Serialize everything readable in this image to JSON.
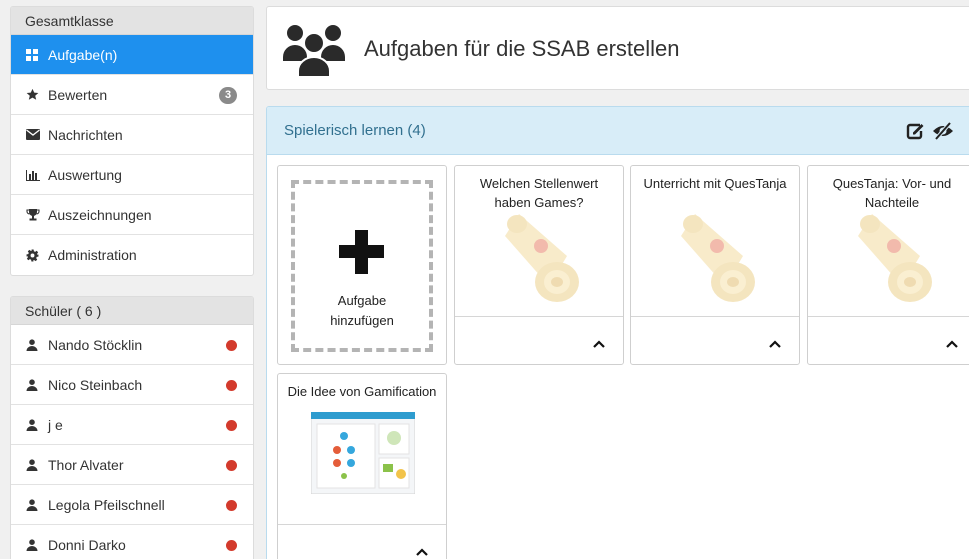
{
  "sidebar": {
    "class_panel": {
      "header": "Gesamtklasse",
      "items": [
        {
          "label": "Aufgabe(n)",
          "icon": "grid-icon",
          "active": true
        },
        {
          "label": "Bewerten",
          "icon": "star-icon",
          "badge": "3"
        },
        {
          "label": "Nachrichten",
          "icon": "envelope-icon"
        },
        {
          "label": "Auswertung",
          "icon": "bar-chart-icon"
        },
        {
          "label": "Auszeichnungen",
          "icon": "trophy-icon"
        },
        {
          "label": "Administration",
          "icon": "gear-icon"
        }
      ]
    },
    "students_panel": {
      "header": "Schüler ( 6 )",
      "items": [
        {
          "name": "Nando Stöcklin",
          "status_color": "#d33a2c"
        },
        {
          "name": "Nico Steinbach",
          "status_color": "#d33a2c"
        },
        {
          "name": "j e",
          "status_color": "#d33a2c"
        },
        {
          "name": "Thor Alvater",
          "status_color": "#d33a2c"
        },
        {
          "name": "Legola Pfeilschnell",
          "status_color": "#d33a2c"
        },
        {
          "name": "Donni Darko",
          "status_color": "#d33a2c"
        }
      ]
    }
  },
  "header": {
    "title": "Aufgaben für die SSAB erstellen",
    "icon": "users-icon"
  },
  "section": {
    "title": "Spielerisch lernen (4)",
    "accent": "#31708f",
    "background": "#d8edf8"
  },
  "add_card": {
    "label_line1": "Aufgabe",
    "label_line2": "hinzufügen"
  },
  "cards": [
    {
      "title": "Welchen Stellenwert haben Games?",
      "thumbnail": "scroll-image"
    },
    {
      "title": "Unterricht mit QuesTanja",
      "thumbnail": "scroll-image"
    },
    {
      "title": "QuesTanja: Vor- und Nachteile",
      "thumbnail": "scroll-image"
    },
    {
      "title": "Die Idee von Gamification",
      "thumbnail": "app-screenshot"
    }
  ],
  "colors": {
    "active_nav": "#1e90ee",
    "status_dot": "#d33a2c"
  }
}
